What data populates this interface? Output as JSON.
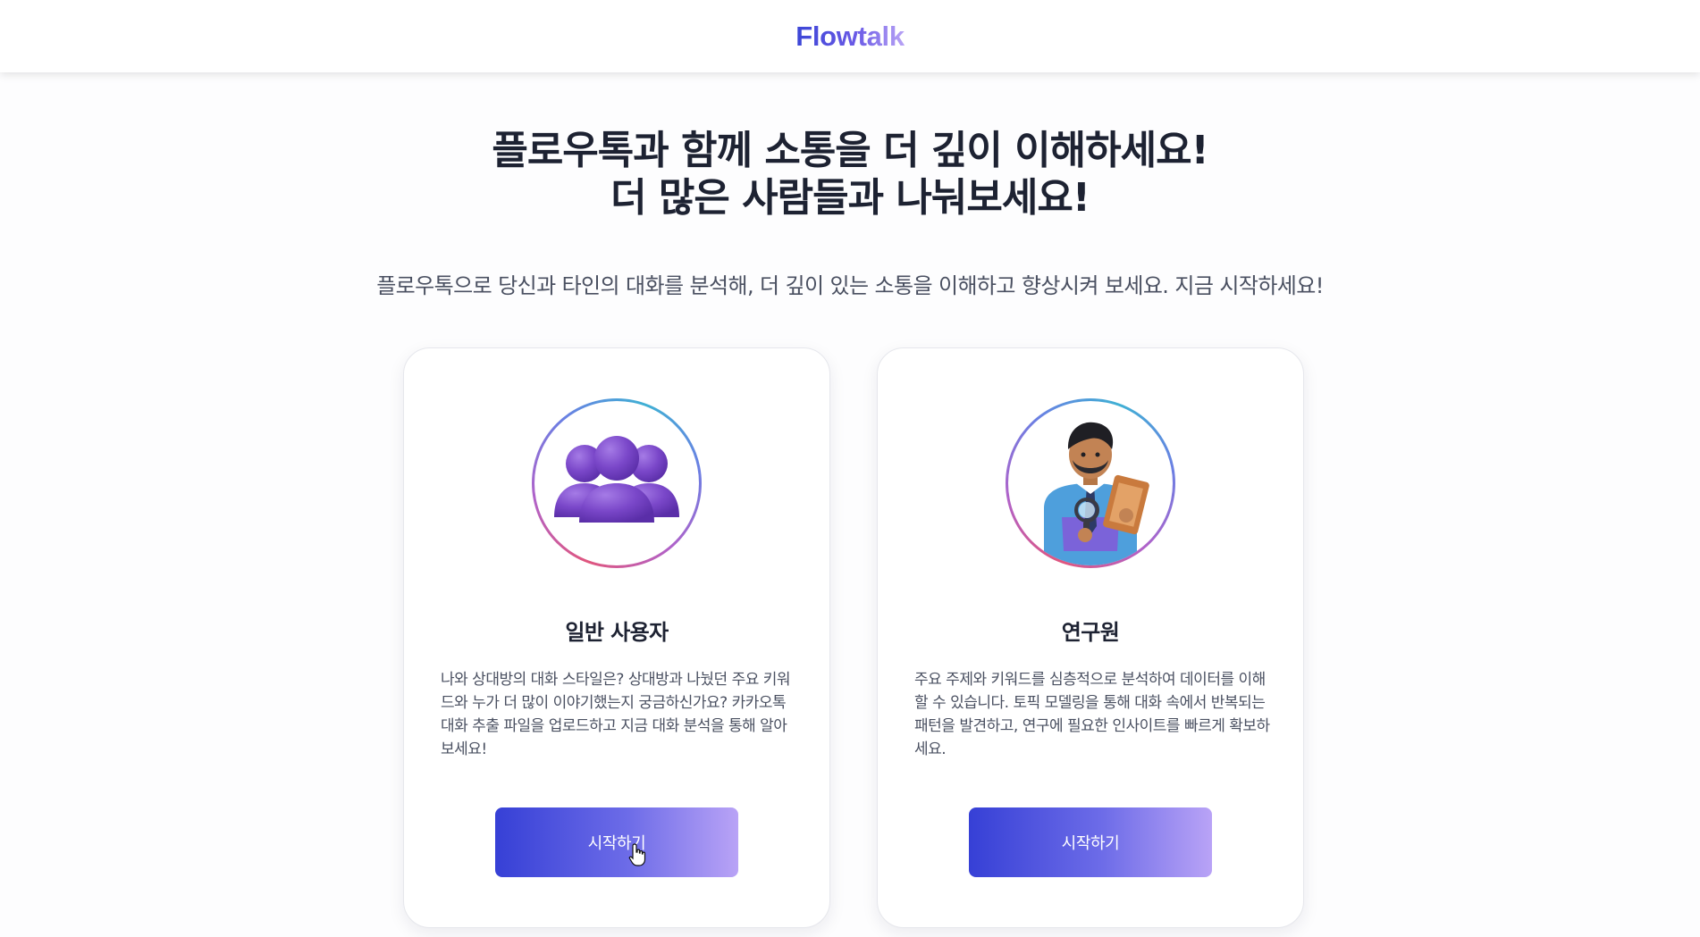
{
  "header": {
    "logo": "Flowtalk"
  },
  "hero": {
    "title_line1": "플로우톡과 함께 소통을 더 깊이 이해하세요!",
    "title_line2": "더 많은 사람들과 나눠보세요!",
    "subtitle": "플로우톡으로 당신과 타인의 대화를 분석해, 더 깊이 있는 소통을 이해하고 향상시켜 보세요. 지금 시작하세요!"
  },
  "cards": [
    {
      "title": "일반 사용자",
      "icon": "users-group-icon",
      "description": "나와 상대방의 대화 스타일은? 상대방과 나눴던 주요 키워드와 누가 더 많이 이야기했는지 궁금하신가요? 카카오톡 대화 추출 파일을 업로드하고 지금 대화 분석을 통해 알아보세요!",
      "button": "시작하기"
    },
    {
      "title": "연구원",
      "icon": "researcher-icon",
      "description": "주요 주제와 키워드를 심층적으로 분석하여 데이터를 이해할 수 있습니다. 토픽 모델링을 통해 대화 속에서 반복되는 패턴을 발견하고, 연구에 필요한 인사이트를 빠르게 확보하세요.",
      "button": "시작하기"
    }
  ],
  "colors": {
    "accent_start": "#3640d6",
    "accent_end": "#b9a3f6",
    "text_dark": "#1d2232",
    "text_muted": "#4a5061"
  }
}
